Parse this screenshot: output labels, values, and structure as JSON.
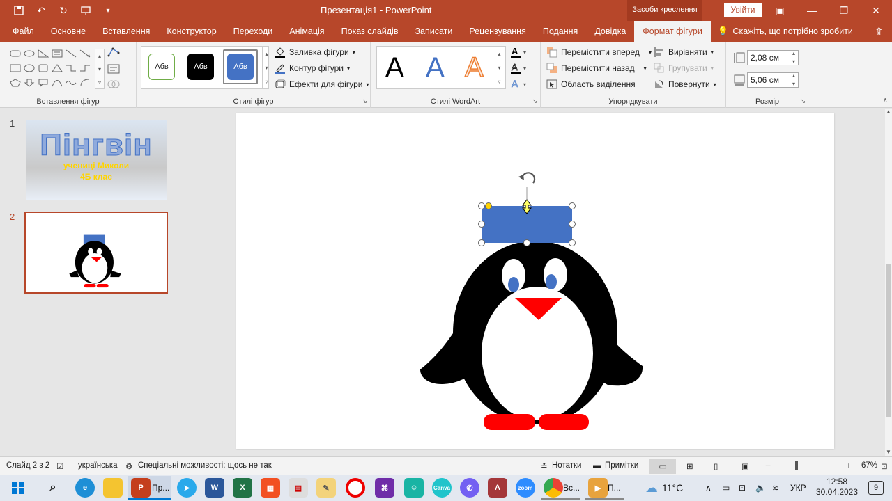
{
  "app": {
    "doc_title": "Презентація1  -  PowerPoint",
    "context_tab_group": "Засоби креслення",
    "sign_in": "Увійти"
  },
  "tabs": [
    "Файл",
    "Основне",
    "Вставлення",
    "Конструктор",
    "Переходи",
    "Анімація",
    "Показ слайдів",
    "Записати",
    "Рецензування",
    "Подання",
    "Довідка",
    "Формат фігури"
  ],
  "tell_me": "Скажіть, що потрібно зробити",
  "ribbon": {
    "insert_shapes_label": "Вставлення фігур",
    "shape_styles_label": "Стилі фігур",
    "style_sample": "Абв",
    "fill": "Заливка фігури",
    "outline": "Контур фігури",
    "effects": "Ефекти для фігури",
    "wordart_label": "Стилі WordArt",
    "wordart_letter": "A",
    "bring_forward": "Перемістити вперед",
    "send_backward": "Перемістити назад",
    "selection_pane": "Область виділення",
    "align": "Вирівняти",
    "group": "Групувати",
    "rotate": "Повернути",
    "arrange_label": "Упорядкувати",
    "height": "2,08 см",
    "width": "5,06 см",
    "size_label": "Розмір"
  },
  "thumbnails": {
    "slide1_num": "1",
    "slide2_num": "2",
    "slide1_title": "Пінгвін",
    "slide1_line2": "учениці Миколи",
    "slide1_line3": "4Б клас"
  },
  "status": {
    "slide_info": "Слайд 2 з 2",
    "language": "українська",
    "accessibility": "Спеціальні можливості: щось не так",
    "notes": "Нотатки",
    "comments": "Примітки",
    "zoom": "67%"
  },
  "taskbar": {
    "ppt_label": "Пр...",
    "chrome_label": "Вс...",
    "extra_label": "П...",
    "weather": "11°C",
    "lang": "УКР",
    "time": "12:58",
    "date": "30.04.2023",
    "notif": "9"
  },
  "colors": {
    "accent": "#b7472a",
    "shape_blue": "#4472c4",
    "penguin_red": "#ff0000"
  }
}
